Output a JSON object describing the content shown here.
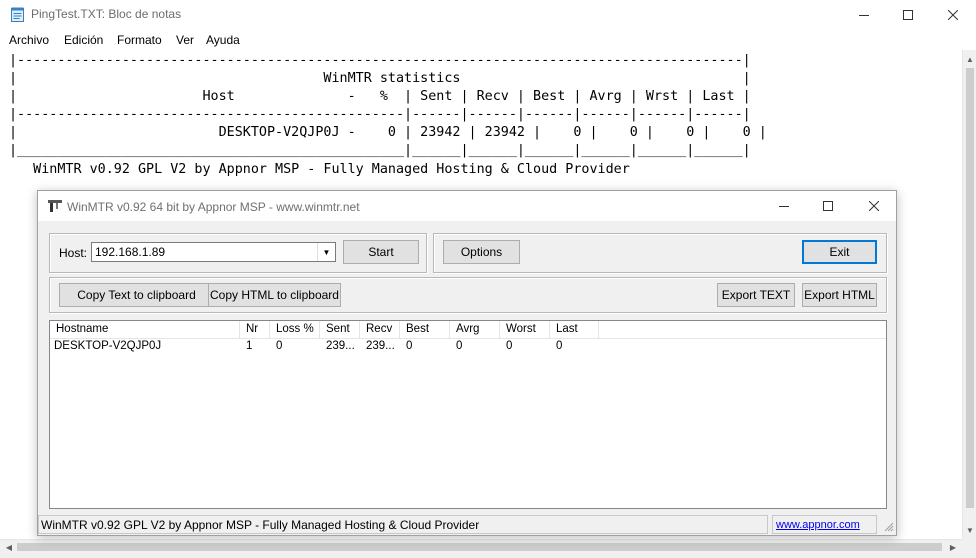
{
  "notepad": {
    "title": "PingTest.TXT: Bloc de notas",
    "menu": [
      "Archivo",
      "Edición",
      "Formato",
      "Ver",
      "Ayuda"
    ],
    "content": "|------------------------------------------------------------------------------------------|\n|                                      WinMTR statistics                                   |\n|                       Host              -   %  | Sent | Recv | Best | Avrg | Wrst | Last |\n|------------------------------------------------|------|------|------|------|------|------|\n|                         DESKTOP-V2QJP0J -    0 | 23942 | 23942 |    0 |    0 |    0 |    0 |\n|________________________________________________|______|______|______|______|______|______|\n   WinMTR v0.92 GPL V2 by Appnor MSP - Fully Managed Hosting & Cloud Provider"
  },
  "winmtr": {
    "title": "WinMTR v0.92 64 bit by Appnor MSP - www.winmtr.net",
    "host_label": "Host:",
    "host_value": "192.168.1.89",
    "buttons": {
      "start": "Start",
      "options": "Options",
      "exit": "Exit",
      "copy_text": "Copy Text to clipboard",
      "copy_html": "Copy HTML to clipboard",
      "export_text": "Export TEXT",
      "export_html": "Export HTML"
    },
    "columns": [
      "Hostname",
      "Nr",
      "Loss %",
      "Sent",
      "Recv",
      "Best",
      "Avrg",
      "Worst",
      "Last"
    ],
    "rows": [
      [
        "DESKTOP-V2QJP0J",
        "1",
        "0",
        "239...",
        "239...",
        "0",
        "0",
        "0",
        "0"
      ]
    ],
    "status_text": "WinMTR v0.92 GPL V2 by Appnor MSP - Fully Managed Hosting & Cloud Provider",
    "status_link": "www.appnor.com"
  },
  "icons": {
    "minimize": "minimize-icon",
    "maximize": "maximize-icon",
    "close": "close-icon",
    "dropdown": "chevron-down-icon",
    "resize": "resize-grip-icon"
  }
}
